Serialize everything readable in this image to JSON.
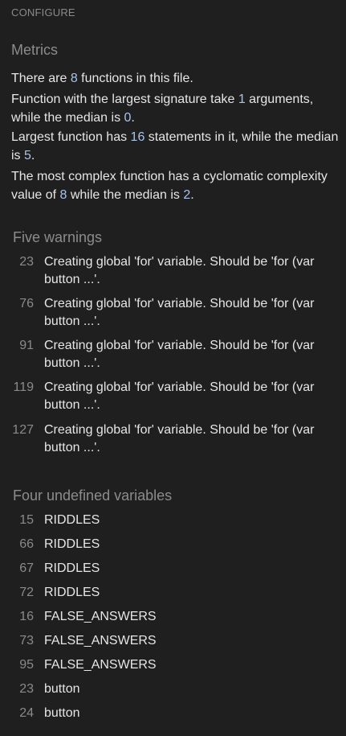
{
  "header": {
    "configure_label": "CONFIGURE"
  },
  "metrics": {
    "title": "Metrics",
    "functions_count": {
      "prefix": "There are ",
      "value": "8",
      "suffix": " functions in this file."
    },
    "signature": {
      "prefix": "Function with the largest signature take ",
      "largest": "1",
      "middle": " arguments, while the median is ",
      "median": "0",
      "suffix": "."
    },
    "statements": {
      "prefix": "Largest function has ",
      "largest": "16",
      "middle": " statements in it, while the median is ",
      "median": "5",
      "suffix": "."
    },
    "complexity": {
      "prefix": "The most complex function has a cyclomatic complexity value of ",
      "largest": "8",
      "middle": " while the median is ",
      "median": "2",
      "suffix": "."
    }
  },
  "warnings": {
    "title": "Five warnings",
    "items": [
      {
        "line": "23",
        "message": "Creating global 'for' variable. Should be 'for (var button ...'."
      },
      {
        "line": "76",
        "message": "Creating global 'for' variable. Should be 'for (var button ...'."
      },
      {
        "line": "91",
        "message": "Creating global 'for' variable. Should be 'for (var button ...'."
      },
      {
        "line": "119",
        "message": "Creating global 'for' variable. Should be 'for (var button ...'."
      },
      {
        "line": "127",
        "message": "Creating global 'for' variable. Should be 'for (var button ...'."
      }
    ]
  },
  "undefined_variables": {
    "title": "Four undefined variables",
    "items": [
      {
        "line": "15",
        "name": "RIDDLES"
      },
      {
        "line": "66",
        "name": "RIDDLES"
      },
      {
        "line": "67",
        "name": "RIDDLES"
      },
      {
        "line": "72",
        "name": "RIDDLES"
      },
      {
        "line": "16",
        "name": "FALSE_ANSWERS"
      },
      {
        "line": "73",
        "name": "FALSE_ANSWERS"
      },
      {
        "line": "95",
        "name": "FALSE_ANSWERS"
      },
      {
        "line": "23",
        "name": "button"
      },
      {
        "line": "24",
        "name": "button"
      }
    ]
  },
  "colors": {
    "background": "#1f1f1f",
    "text": "#e6e6e6",
    "muted": "#8a8a8a",
    "number_accent": "#a9c3ea"
  }
}
